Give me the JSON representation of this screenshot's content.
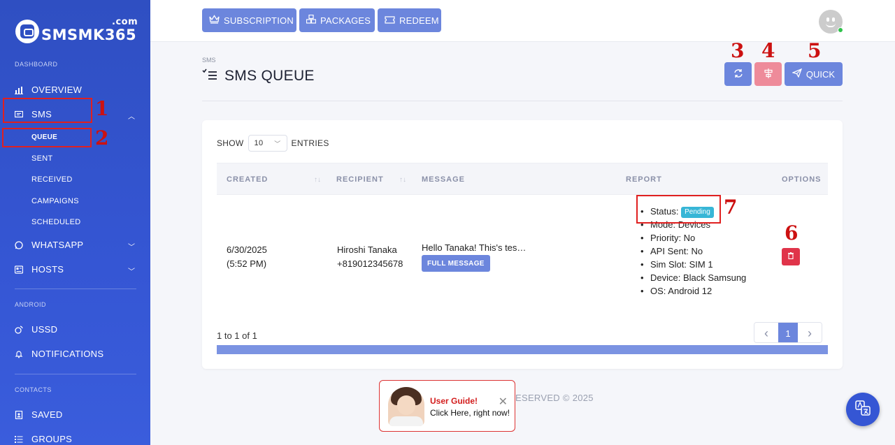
{
  "sidebar": {
    "logo_text": "SMSMK365",
    "logo_suffix": ".com",
    "sections": {
      "dashboard": "DASHBOARD",
      "android": "ANDROID",
      "contacts": "CONTACTS"
    },
    "items": {
      "overview": "OVERVIEW",
      "sms": "SMS",
      "queue": "QUEUE",
      "sent": "SENT",
      "received": "RECEIVED",
      "campaigns": "CAMPAIGNS",
      "scheduled": "SCHEDULED",
      "whatsapp": "WHATSAPP",
      "hosts": "HOSTS",
      "ussd": "USSD",
      "notifications": "NOTIFICATIONS",
      "saved": "SAVED",
      "groups": "GROUPS"
    }
  },
  "topbar": {
    "subscription": "SUBSCRIPTION",
    "packages": "PACKAGES",
    "redeem": "REDEEM"
  },
  "page": {
    "breadcrumb": "SMS",
    "title": "SMS QUEUE",
    "quick_label": "QUICK"
  },
  "annotations": [
    "1",
    "2",
    "3",
    "4",
    "5",
    "6",
    "7"
  ],
  "table": {
    "show": "SHOW",
    "entries_value": "10",
    "entries": "ENTRIES",
    "headers": [
      "CREATED",
      "RECIPIENT",
      "MESSAGE",
      "REPORT",
      "OPTIONS"
    ],
    "row": {
      "created_date": "6/30/2025",
      "created_time": "(5:52 PM)",
      "recipient_name": "Hiroshi Tanaka",
      "recipient_phone": "+819012345678",
      "message": "Hello Tanaka! This's tes…",
      "full_message_label": "FULL MESSAGE",
      "report": {
        "status_label": "Status:",
        "status_value": "Pending",
        "mode": "Mode: Devices",
        "priority": "Priority: No",
        "api_sent": "API Sent: No",
        "sim_slot": "Sim Slot: SIM 1",
        "device": "Device: Black Samsung",
        "os": "OS: Android 12"
      }
    },
    "summary": "1 to 1 of 1",
    "pager": {
      "prev": "‹",
      "current": "1",
      "next": "›"
    }
  },
  "footer": "ESERVED © 2025",
  "guide": {
    "title": "User Guide!",
    "subtitle": "Click Here, right now!",
    "close": "✕"
  },
  "colors": {
    "sidebar": "#3556d4",
    "primary_button": "#6c86dd",
    "danger": "#e0344a",
    "pending_badge": "#37b6d6",
    "annotation_red": "#cc1111"
  }
}
